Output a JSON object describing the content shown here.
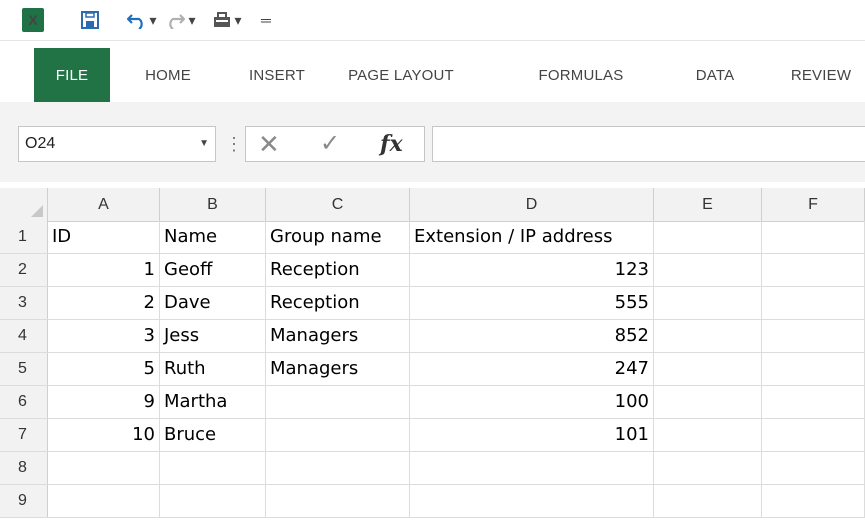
{
  "window": {
    "app_logo_label": "X",
    "icons": [
      "excel-logo",
      "save-icon",
      "undo-icon",
      "redo-icon",
      "clipboard-icon",
      "customize-icon"
    ]
  },
  "ribbon": {
    "tabs": [
      "FILE",
      "HOME",
      "INSERT",
      "PAGE LAYOUT",
      "FORMULAS",
      "DATA",
      "REVIEW"
    ],
    "active_tab": "FILE",
    "active_color": "#217346"
  },
  "formula_bar": {
    "name_box": "O24",
    "fx_label": "fx",
    "formula": ""
  },
  "sheet": {
    "columns": [
      "A",
      "B",
      "C",
      "D",
      "E",
      "F"
    ],
    "row_numbers": [
      "1",
      "2",
      "3",
      "4",
      "5",
      "6",
      "7",
      "8",
      "9"
    ],
    "rows": [
      [
        "ID",
        "Name",
        "Group name",
        "Extension / IP address",
        "",
        ""
      ],
      [
        "1",
        "Geoff",
        "Reception",
        "123",
        "",
        ""
      ],
      [
        "2",
        "Dave",
        "Reception",
        "555",
        "",
        ""
      ],
      [
        "3",
        "Jess",
        "Managers",
        "852",
        "",
        ""
      ],
      [
        "5",
        "Ruth",
        "Managers",
        "247",
        "",
        ""
      ],
      [
        "9",
        "Martha",
        "",
        "100",
        "",
        ""
      ],
      [
        "10",
        "Bruce",
        "",
        "101",
        "",
        ""
      ],
      [
        "",
        "",
        "",
        "",
        "",
        ""
      ],
      [
        "",
        "",
        "",
        "",
        "",
        ""
      ]
    ]
  }
}
